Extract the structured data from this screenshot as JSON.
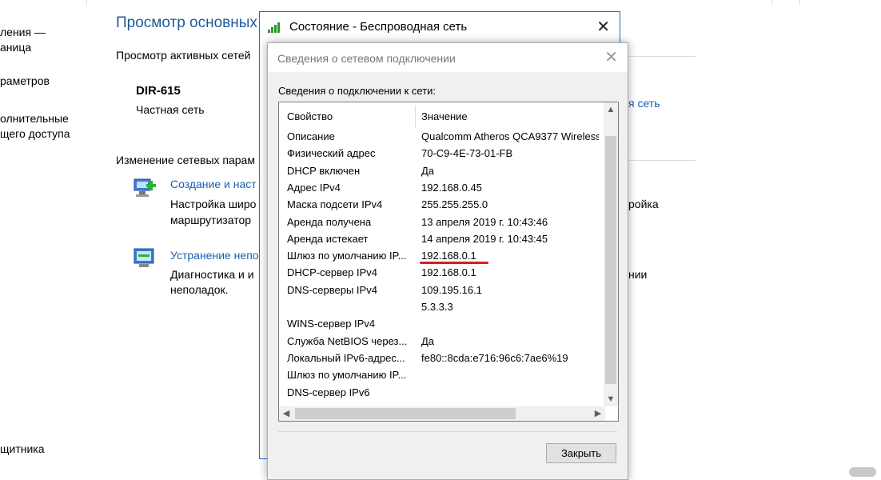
{
  "background": {
    "left_items": [
      "ления —",
      "аница",
      "раметров",
      "олнительные",
      "щего доступа",
      "щитника"
    ],
    "heading": "Просмотр основных",
    "active_networks_label": "Просмотр активных сетей",
    "network_name": "DIR-615",
    "network_type": "Частная сеть",
    "right_link": "я сеть",
    "change_settings_label": "Изменение сетевых парам",
    "create_link": "Создание и наст",
    "create_desc_1": "Настройка широ",
    "create_desc_2": "маршрутизатор",
    "create_desc_right": "ройка",
    "troubleshoot_link": "Устранение непо",
    "troubleshoot_desc_1": "Диагностика и и",
    "troubleshoot_desc_2": "неполадок.",
    "troubleshoot_desc_right": "нии"
  },
  "status_window": {
    "title": "Состояние - Беспроводная сеть",
    "close": "✕"
  },
  "details_dialog": {
    "title": "Сведения о сетевом подключении",
    "close": "✕",
    "group_label": "Сведения о подключении к сети:",
    "columns": [
      "Свойство",
      "Значение"
    ],
    "rows": [
      [
        "Описание",
        "Qualcomm Atheros QCA9377 Wireless"
      ],
      [
        "Физический адрес",
        "70-C9-4E-73-01-FB"
      ],
      [
        "DHCP включен",
        "Да"
      ],
      [
        "Адрес IPv4",
        "192.168.0.45"
      ],
      [
        "Маска подсети IPv4",
        "255.255.255.0"
      ],
      [
        "Аренда получена",
        "13 апреля 2019 г. 10:43:46"
      ],
      [
        "Аренда истекает",
        "14 апреля 2019 г. 10:43:45"
      ],
      [
        "Шлюз по умолчанию IP...",
        "192.168.0.1"
      ],
      [
        "DHCP-сервер IPv4",
        "192.168.0.1"
      ],
      [
        "DNS-серверы IPv4",
        "109.195.16.1"
      ],
      [
        "",
        "5.3.3.3"
      ],
      [
        "WINS-сервер IPv4",
        ""
      ],
      [
        "Служба NetBIOS через...",
        "Да"
      ],
      [
        "Локальный IPv6-адрес...",
        "fe80::8cda:e716:96c6:7ae6%19"
      ],
      [
        "Шлюз по умолчанию IP...",
        ""
      ],
      [
        "DNS-сервер IPv6",
        ""
      ]
    ],
    "close_button": "Закрыть"
  },
  "colors": {
    "link_blue": "#1a5fb4",
    "window_border": "#1d6ad3",
    "highlight_red": "#d81e1e"
  }
}
